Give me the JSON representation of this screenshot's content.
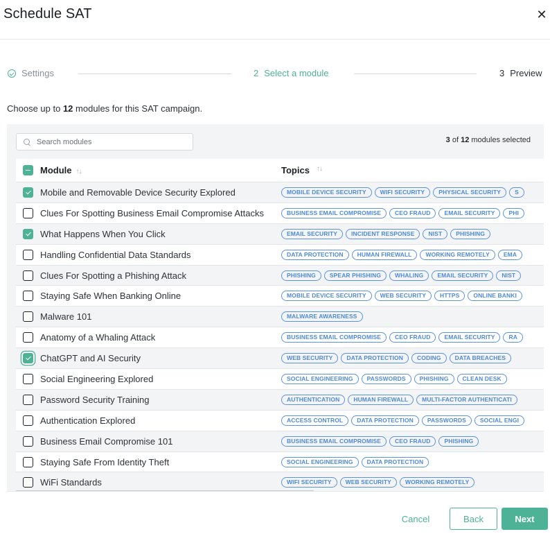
{
  "dialog": {
    "title": "Schedule SAT",
    "close_icon": "close-icon"
  },
  "stepper": {
    "steps": [
      {
        "number": "",
        "label": "Settings",
        "state": "complete",
        "icon": "check-circle-icon"
      },
      {
        "number": "2",
        "label": "Select a module",
        "state": "active"
      },
      {
        "number": "3",
        "label": "Preview",
        "state": "upcoming"
      }
    ]
  },
  "intro": {
    "prefix": "Choose up to ",
    "max": "12",
    "suffix": " modules for this SAT campaign."
  },
  "search": {
    "placeholder": "Search modules",
    "value": "",
    "icon": "search-icon"
  },
  "selection": {
    "selected": "3",
    "of": " of ",
    "total": "12",
    "suffix": " modules selected"
  },
  "table": {
    "columns": [
      {
        "label": "Module",
        "sort_icon": "sort-icon"
      },
      {
        "label": "Topics",
        "sort_icon": "sort-icon"
      }
    ],
    "header_checkbox_state": "indeterminate",
    "rows": [
      {
        "module": "Mobile and Removable Device Security Explored",
        "checked": true,
        "topics": [
          "MOBILE DEVICE SECURITY",
          "WIFI SECURITY",
          "PHYSICAL SECURITY",
          "S"
        ]
      },
      {
        "module": "Clues For Spotting Business Email Compromise Attacks",
        "checked": false,
        "topics": [
          "BUSINESS EMAIL COMPROMISE",
          "CEO FRAUD",
          "EMAIL SECURITY",
          "PHI"
        ]
      },
      {
        "module": "What Happens When You Click",
        "checked": true,
        "topics": [
          "EMAIL SECURITY",
          "INCIDENT RESPONSE",
          "NIST",
          "PHISHING"
        ]
      },
      {
        "module": "Handling Confidential Data Standards",
        "checked": false,
        "topics": [
          "DATA PROTECTION",
          "HUMAN FIREWALL",
          "WORKING REMOTELY",
          "EMA"
        ]
      },
      {
        "module": "Clues For Spotting a Phishing Attack",
        "checked": false,
        "topics": [
          "PHISHING",
          "SPEAR PHISHING",
          "WHALING",
          "EMAIL SECURITY",
          "NIST"
        ]
      },
      {
        "module": "Staying Safe When Banking Online",
        "checked": false,
        "topics": [
          "MOBILE DEVICE SECURITY",
          "WEB SECURITY",
          "HTTPS",
          "ONLINE BANKI"
        ]
      },
      {
        "module": "Malware 101",
        "checked": false,
        "topics": [
          "MALWARE AWARENESS"
        ]
      },
      {
        "module": "Anatomy of a Whaling Attack",
        "checked": false,
        "topics": [
          "BUSINESS EMAIL COMPROMISE",
          "CEO FRAUD",
          "EMAIL SECURITY",
          "RA"
        ]
      },
      {
        "module": "ChatGPT and AI Security",
        "checked": true,
        "focused": true,
        "topics": [
          "WEB SECURITY",
          "DATA PROTECTION",
          "CODING",
          "DATA BREACHES"
        ]
      },
      {
        "module": "Social Engineering Explored",
        "checked": false,
        "topics": [
          "SOCIAL ENGINEERING",
          "PASSWORDS",
          "PHISHING",
          "CLEAN DESK"
        ]
      },
      {
        "module": "Password Security Training",
        "checked": false,
        "topics": [
          "AUTHENTICATION",
          "HUMAN FIREWALL",
          "MULTI-FACTOR AUTHENTICATI"
        ]
      },
      {
        "module": "Authentication Explored",
        "checked": false,
        "topics": [
          "ACCESS CONTROL",
          "DATA PROTECTION",
          "PASSWORDS",
          "SOCIAL ENGI"
        ]
      },
      {
        "module": "Business Email Compromise 101",
        "checked": false,
        "topics": [
          "BUSINESS EMAIL COMPROMISE",
          "CEO FRAUD",
          "PHISHING"
        ]
      },
      {
        "module": "Staying Safe From Identity Theft",
        "checked": false,
        "topics": [
          "SOCIAL ENGINEERING",
          "DATA PROTECTION"
        ]
      },
      {
        "module": "WiFi Standards",
        "checked": false,
        "topics": [
          "WIFI SECURITY",
          "WEB SECURITY",
          "WORKING REMOTELY"
        ]
      }
    ]
  },
  "footer": {
    "cancel_label": "Cancel",
    "back_label": "Back",
    "next_label": "Next"
  },
  "colors": {
    "accent": "#4db296",
    "tag": "#4e8ad9"
  }
}
